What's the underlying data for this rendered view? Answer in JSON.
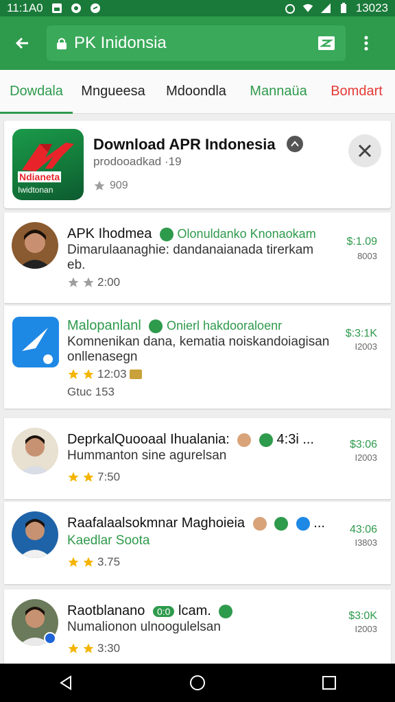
{
  "status_bar": {
    "time": "11:1A0",
    "right_text": "13023"
  },
  "toolbar": {
    "url_text": "PK Inidonsia"
  },
  "tabs": [
    {
      "label": "Dowdala",
      "color": "#2e9a4c"
    },
    {
      "label": "Mngueesa",
      "color": "#222222"
    },
    {
      "label": "Mdoondla",
      "color": "#222222"
    },
    {
      "label": "Mannaüa",
      "color": "#2e9a4c"
    },
    {
      "label": "Bomdart",
      "color": "#e53935"
    }
  ],
  "header_card": {
    "logo_text_1": "Ndianeta",
    "logo_text_2": "Iwidtonan",
    "title": "Download APR Indonesia",
    "subtitle": "prodooadkad ·19",
    "rating": "909"
  },
  "rows": [
    {
      "name": "APK Ihodmea",
      "badge_text": "Olonuldanko Knonaokam",
      "desc1": "Dimarulaanaghie: dandanaianada tirerkam",
      "desc2": "eb.",
      "rating": "2:00",
      "price": "$:1.09",
      "count": "8003"
    },
    {
      "name": "Malopanlanl",
      "badge_text": "Onierl hakdooraloenr",
      "desc1": "Komnenikan dana, kematia noiskandoiagisan",
      "desc2": "onllenasegn",
      "rating": "12:03",
      "extra": "Gtuc   153",
      "price": "$:3:1K",
      "count": "I2003"
    },
    {
      "name": "DeprkalQuooaal Ihualania:",
      "suffix": "4:3i ...",
      "desc1": "Hummanton sine agurelsan",
      "rating": "7:50",
      "price": "$3:06",
      "count": "I2003"
    },
    {
      "name": "Raafalaalsokmnar Maghoieia",
      "suffix": "...",
      "desc1": "Kaedlar Soota",
      "rating": "3.75",
      "price": "43:06",
      "count": "I3803"
    },
    {
      "name": "Raotblanano",
      "badge_text": "0:0",
      "name_tail": "lcam.",
      "desc1": "Numalionon ulnoogulelsan",
      "rating": "3:30",
      "price": "$3:0K",
      "count": "I2003"
    }
  ],
  "colors": {
    "accent": "#2e9a4c",
    "star": "#f4b400",
    "grey_star": "#9e9e9e"
  }
}
